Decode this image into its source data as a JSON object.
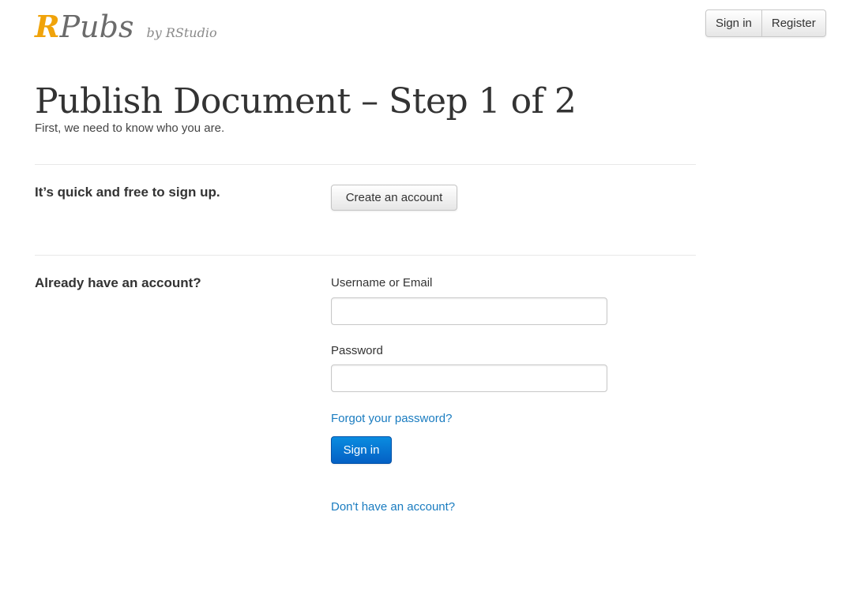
{
  "brand": {
    "r": "R",
    "pubs": "Pubs",
    "by": "by RStudio"
  },
  "nav": {
    "sign_in": "Sign in",
    "register": "Register"
  },
  "page": {
    "title": "Publish Document – Step 1 of 2",
    "subtitle": "First, we need to know who you are."
  },
  "signup": {
    "label": "It’s quick and free to sign up.",
    "button": "Create an account"
  },
  "login": {
    "label": "Already have an account?",
    "username_label": "Username or Email",
    "username_value": "",
    "password_label": "Password",
    "password_value": "",
    "forgot_link": "Forgot your password?",
    "submit": "Sign in",
    "no_account_link": "Don't have an account?"
  },
  "colors": {
    "brand_r": "#f0a30a",
    "primary": "#0a74d0",
    "link": "#1a7cc0"
  }
}
